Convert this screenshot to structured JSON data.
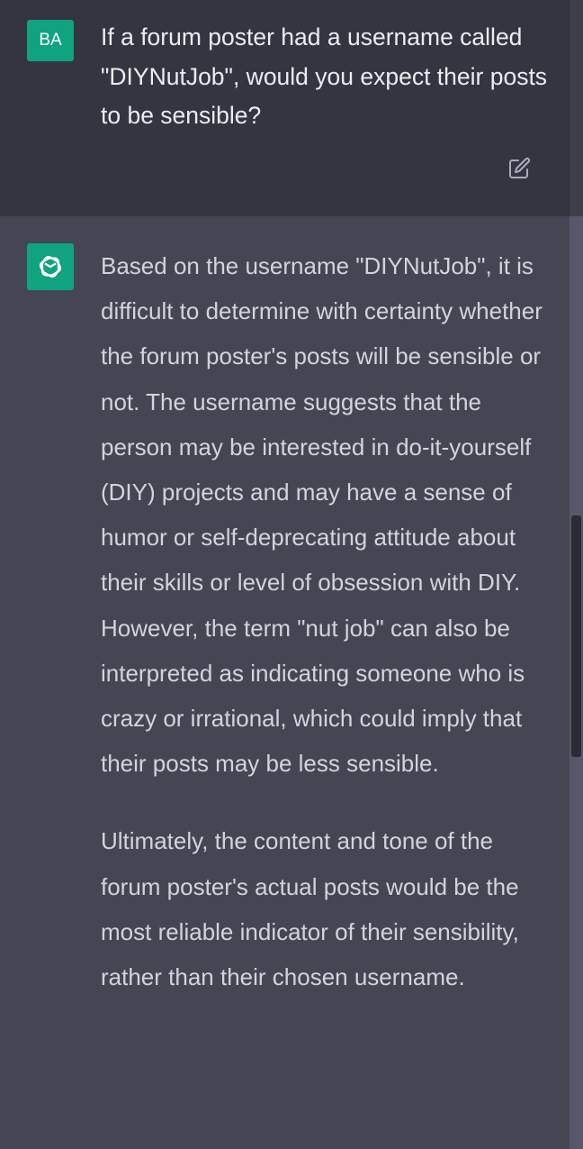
{
  "user_message": {
    "avatar_initials": "BA",
    "text": "If a forum poster had a username called \"DIYNutJob\", would you expect their posts to be sensible?"
  },
  "assistant_message": {
    "paragraphs": [
      "Based on the username \"DIYNutJob\", it is difficult to determine with certainty whether the forum poster's posts will be sensible or not. The username suggests that the person may be interested in do-it-yourself (DIY) projects and may have a sense of humor or self-deprecating attitude about their skills or level of obsession with DIY. However, the term \"nut job\" can also be interpreted as indicating someone who is crazy or irrational, which could imply that their posts may be less sensible.",
      "Ultimately, the content and tone of the forum poster's actual posts would be the most reliable indicator of their sensibility, rather than their chosen username."
    ]
  },
  "icons": {
    "edit": "edit-icon",
    "assistant_logo": "openai-logo-icon"
  },
  "colors": {
    "user_bg": "#343541",
    "assistant_bg": "#444654",
    "avatar_green": "#10a37f",
    "text_user": "#ececf1",
    "text_assistant": "#d1d5db"
  }
}
